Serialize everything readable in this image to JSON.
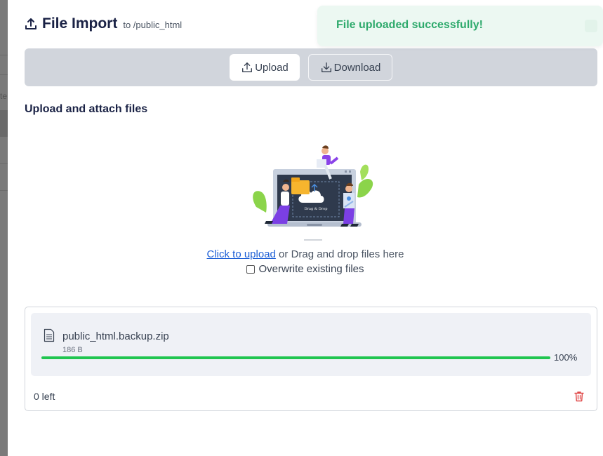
{
  "header": {
    "icon": "upload-icon",
    "title": "File Import",
    "subtitle": "to /public_html"
  },
  "toast": {
    "message": "File uploaded successfully!",
    "color": "#2eaa6c"
  },
  "tabs": [
    {
      "label": "Upload",
      "icon": "upload-icon",
      "active": true
    },
    {
      "label": "Download",
      "icon": "download-icon",
      "active": false
    }
  ],
  "section": {
    "title": "Upload and attach files"
  },
  "dropzone": {
    "link": "Click to upload",
    "text": " or Drag and drop files here",
    "illustration_label": "Drag & Drop"
  },
  "overwrite": {
    "label": "Overwrite existing files",
    "checked": false
  },
  "file": {
    "name": "public_html.backup.zip",
    "size": "186 B",
    "progress": 100,
    "progress_label": "100%",
    "progress_color": "#20c550"
  },
  "footer": {
    "remaining": "0 left",
    "delete_icon": "trash-icon"
  }
}
